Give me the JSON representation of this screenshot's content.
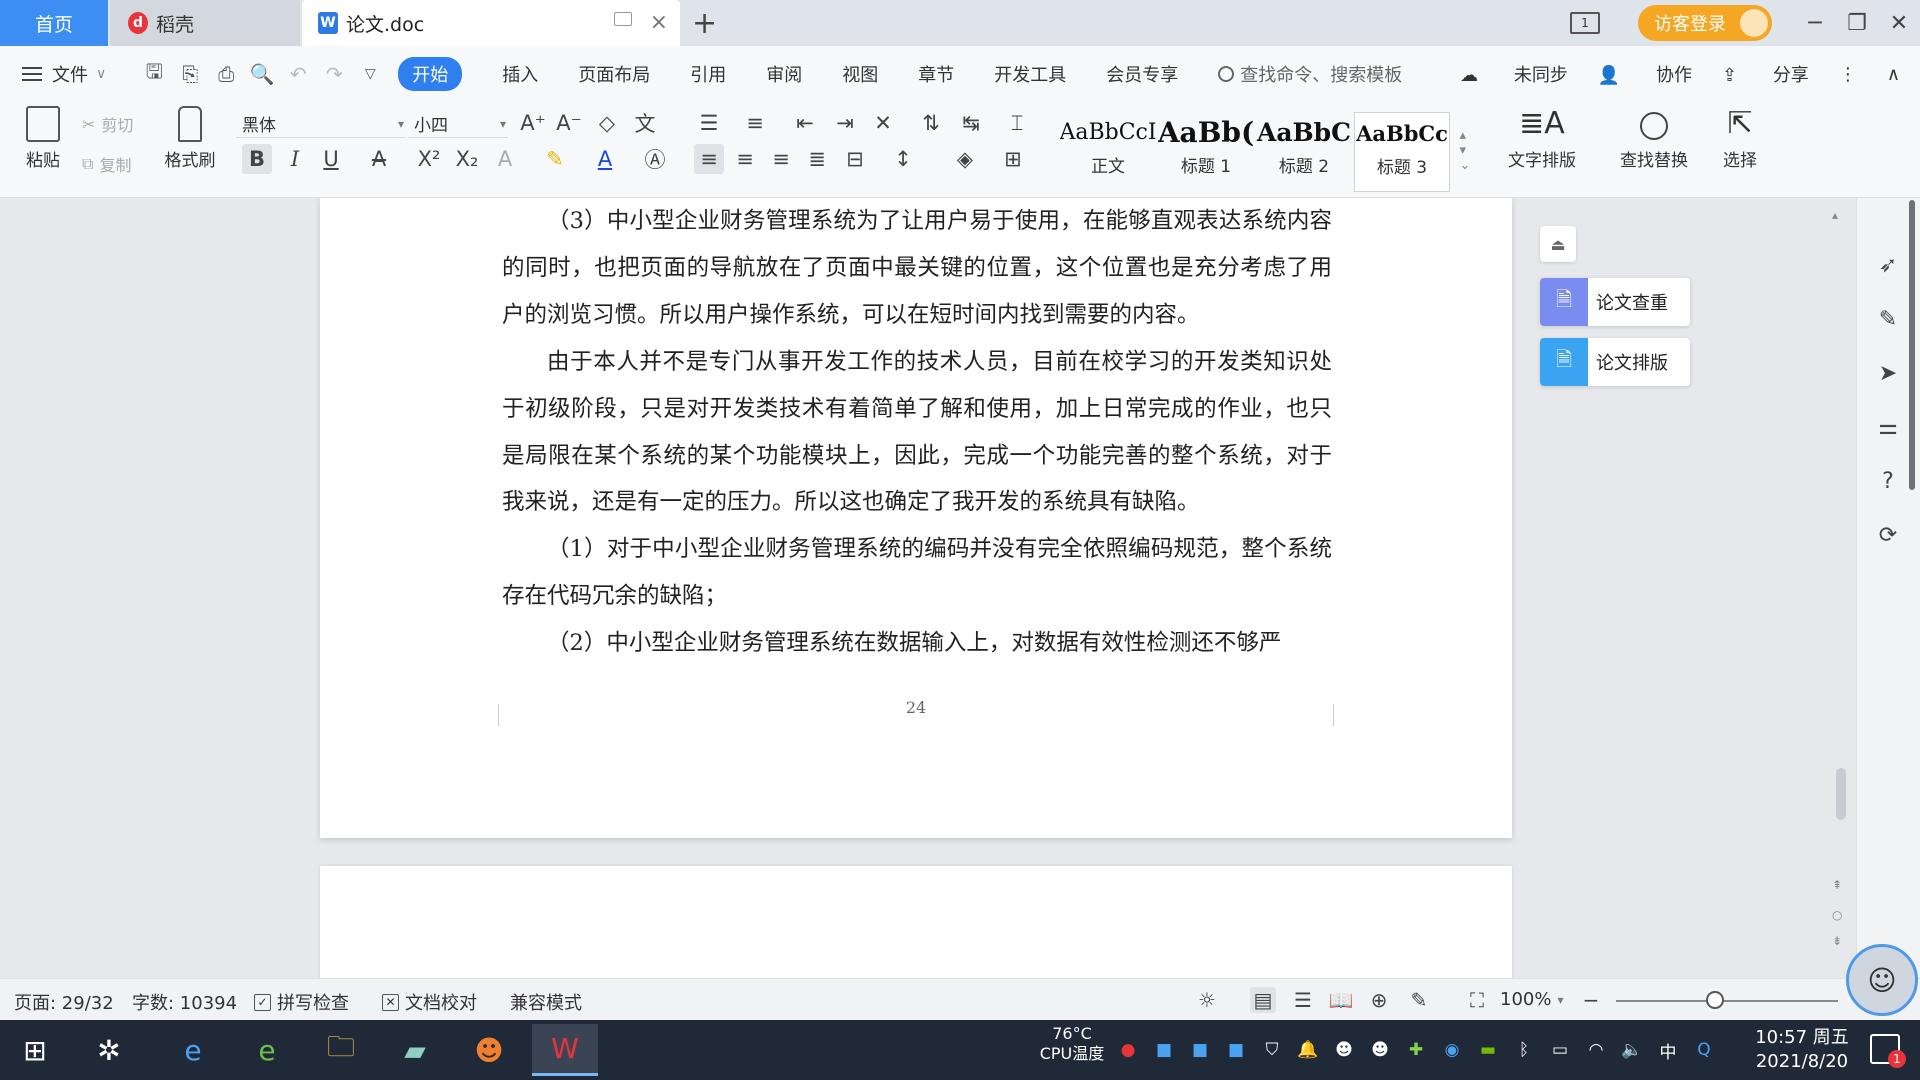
{
  "tabs": {
    "home": "首页",
    "daoke": "稻壳",
    "doc": "论文.doc",
    "add": "+"
  },
  "window": {
    "layout_badge": "1",
    "guest_login": "访客登录",
    "minimize": "─",
    "restore": "❐",
    "close": "✕"
  },
  "menubar": {
    "file": "文件",
    "tabs": [
      "开始",
      "插入",
      "页面布局",
      "引用",
      "审阅",
      "视图",
      "章节",
      "开发工具",
      "会员专享"
    ],
    "search_placeholder": "查找命令、搜索模板",
    "unsync": "未同步",
    "collab": "协作",
    "share": "分享"
  },
  "ribbon": {
    "paste": "粘贴",
    "cut": "剪切",
    "copy": "复制",
    "format_painter": "格式刷",
    "font_name": "黑体",
    "font_size": "小四",
    "styles": [
      {
        "sample": "AaBbCcI",
        "name": "正文"
      },
      {
        "sample": "AaBb(",
        "name": "标题 1"
      },
      {
        "sample": "AaBbC",
        "name": "标题 2"
      },
      {
        "sample": "AaBbCc",
        "name": "标题 3"
      }
    ],
    "text_layout": "文字排版",
    "find_replace": "查找替换",
    "select": "选择"
  },
  "document": {
    "paragraphs": [
      "（3）中小型企业财务管理系统为了让用户易于使用，在能够直观表达系统内容的同时，也把页面的导航放在了页面中最关键的位置，这个位置也是充分考虑了用户的浏览习惯。所以用户操作系统，可以在短时间内找到需要的内容。",
      "由于本人并不是专门从事开发工作的技术人员，目前在校学习的开发类知识处于初级阶段，只是对开发类技术有着简单了解和使用，加上日常完成的作业，也只是局限在某个系统的某个功能模块上，因此，完成一个功能完善的整个系统，对于我来说，还是有一定的压力。所以这也确定了我开发的系统具有缺陷。",
      "（1）对于中小型企业财务管理系统的编码并没有完全依照编码规范，整个系统存在代码冗余的缺陷；",
      "（2）中小型企业财务管理系统在数据输入上，对数据有效性检测还不够严"
    ],
    "page_number": "24"
  },
  "float_panel": {
    "check": "论文查重",
    "format": "论文排版"
  },
  "statusbar": {
    "page": "页面: 29/32",
    "words": "字数: 10394",
    "spell_check": "拼写检查",
    "doc_proof": "文档校对",
    "compat_mode": "兼容模式",
    "zoom": "100%",
    "zoom_level_percent": 100
  },
  "taskbar": {
    "cpu_temp": "76°C",
    "cpu_label": "CPU温度",
    "ime": "中",
    "time": "10:57 周五",
    "date": "2021/8/20",
    "notification_count": "1"
  },
  "colors": {
    "accent": "#2f7ff0",
    "home_tab": "#3c8ef3",
    "guest_login": "#f5a623",
    "taskbar": "#1f2937"
  }
}
